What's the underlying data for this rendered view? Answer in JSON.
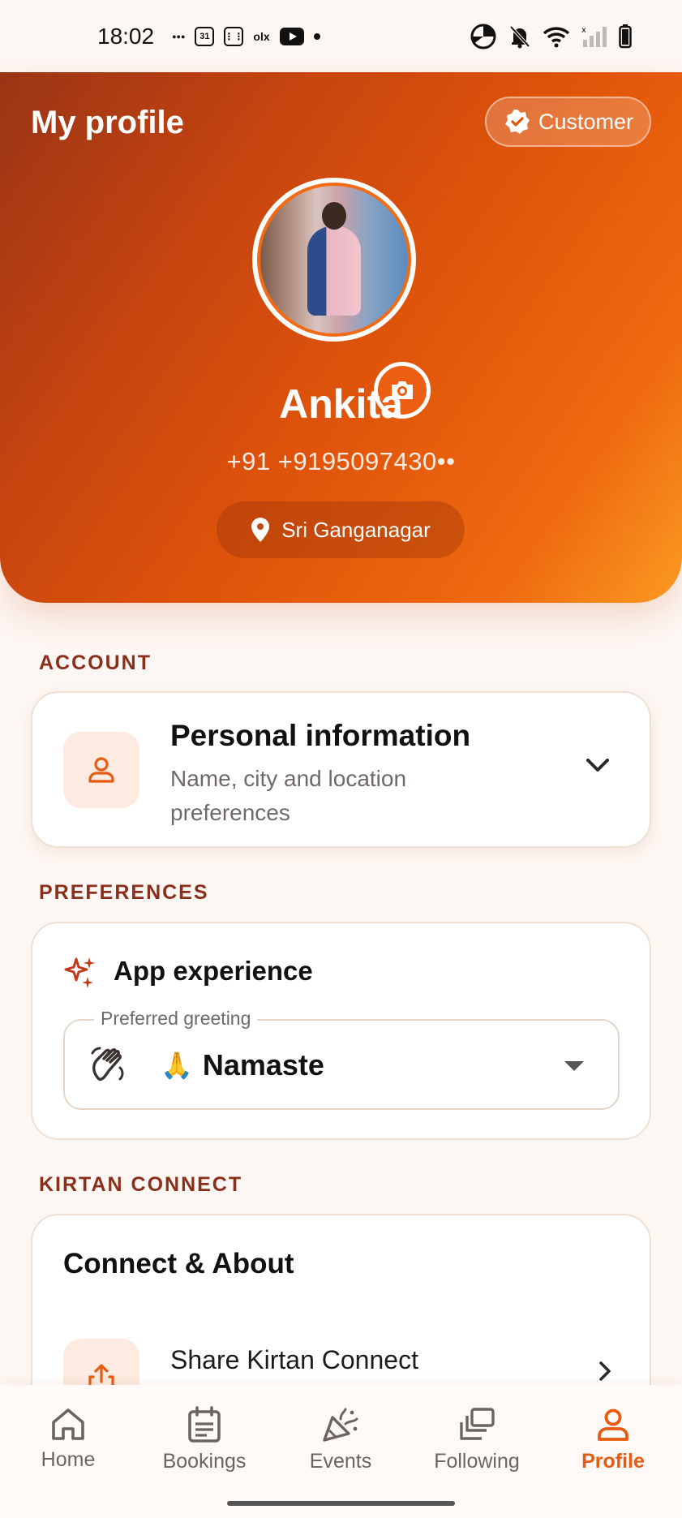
{
  "status_bar": {
    "time": "18:02",
    "left_icons": [
      "oppo-icon",
      "calendar-icon",
      "app-grid-icon",
      "olx-icon",
      "youtube-icon",
      "dot-icon"
    ],
    "right_icons": [
      "data-saver-icon",
      "bell-off-icon",
      "wifi-icon",
      "signal-icon",
      "battery-icon"
    ],
    "calendar_text": "31",
    "olx_text": "olx"
  },
  "header": {
    "title": "My profile",
    "role_badge": "Customer",
    "name": "Ankita",
    "phone": "+91 +9195097430••",
    "location": "Sri Ganganagar"
  },
  "sections": {
    "account": {
      "label": "ACCOUNT",
      "personal_info": {
        "title": "Personal information",
        "subtitle": "Name, city and location preferences"
      }
    },
    "preferences": {
      "label": "PREFERENCES",
      "app_experience_title": "App experience",
      "greeting_label": "Preferred greeting",
      "greeting_emoji": "🙏",
      "greeting_value": "Namaste"
    },
    "kirtan_connect": {
      "label": "KIRTAN CONNECT",
      "card_title": "Connect & About",
      "share_item": "Share Kirtan Connect"
    }
  },
  "bottom_nav": {
    "items": [
      {
        "label": "Home",
        "icon": "home-icon"
      },
      {
        "label": "Bookings",
        "icon": "calendar-list-icon"
      },
      {
        "label": "Events",
        "icon": "party-popper-icon"
      },
      {
        "label": "Following",
        "icon": "stack-icon"
      },
      {
        "label": "Profile",
        "icon": "person-icon"
      }
    ],
    "active_index": 4
  },
  "colors": {
    "accent": "#e85a10",
    "section_label": "#8a2f1c",
    "header_gradient_start": "#9a3415",
    "header_gradient_end": "#fb9a22"
  }
}
